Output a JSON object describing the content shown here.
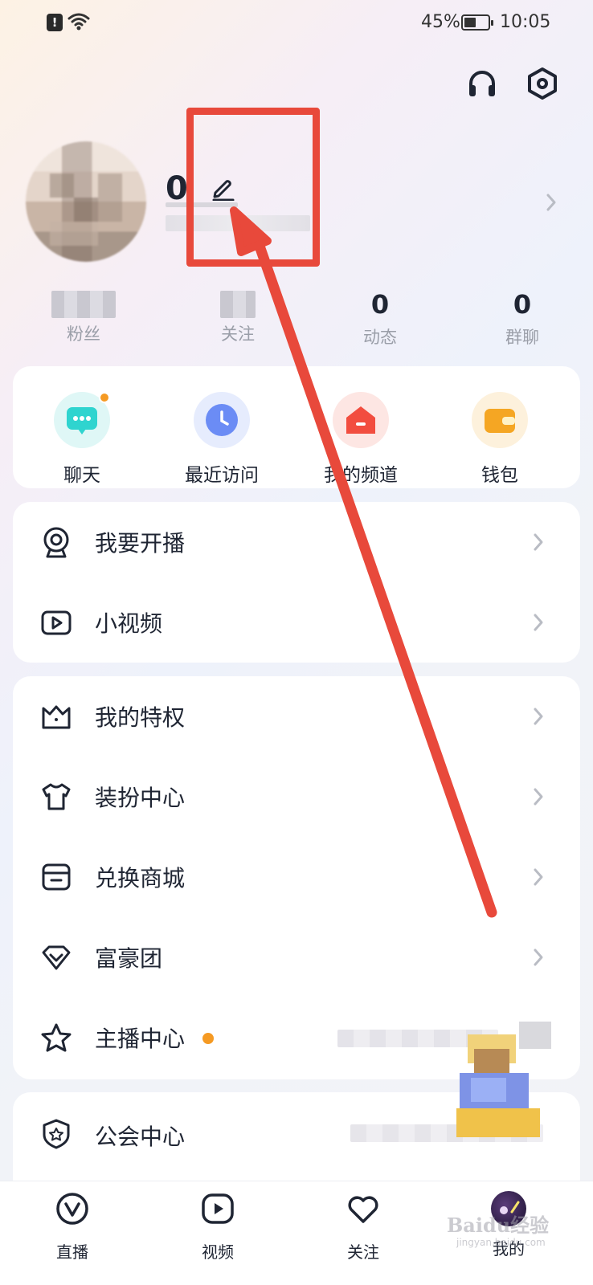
{
  "status_bar": {
    "battery_percent": "45%",
    "time": "10:05",
    "alert_glyph": "!"
  },
  "header": {
    "icons": [
      "headphones-icon",
      "settings-hexagon-icon"
    ]
  },
  "profile": {
    "name": "0"
  },
  "stats": [
    {
      "label": "粉丝",
      "value": ""
    },
    {
      "label": "关注",
      "value": ""
    },
    {
      "label": "动态",
      "value": "0"
    },
    {
      "label": "群聊",
      "value": "0"
    }
  ],
  "shortcuts": [
    {
      "label": "聊天",
      "icon": "chat-bubble-icon",
      "color": "#2fd4cf"
    },
    {
      "label": "最近访问",
      "icon": "clock-icon",
      "color": "#6b8cf5"
    },
    {
      "label": "我的频道",
      "icon": "house-icon",
      "color": "#f24d3f"
    },
    {
      "label": "钱包",
      "icon": "wallet-icon",
      "color": "#f5a623"
    }
  ],
  "menu_group_1": [
    {
      "label": "我要开播",
      "icon": "webcam-icon"
    },
    {
      "label": "小视频",
      "icon": "video-play-icon"
    }
  ],
  "menu_group_2": [
    {
      "label": "我的特权",
      "icon": "crown-icon"
    },
    {
      "label": "装扮中心",
      "icon": "tshirt-icon"
    },
    {
      "label": "兑换商城",
      "icon": "store-icon"
    },
    {
      "label": "富豪团",
      "icon": "diamond-icon"
    },
    {
      "label": "主播中心",
      "icon": "star-icon"
    }
  ],
  "menu_group_3": [
    {
      "label": "公会中心",
      "icon": "shield-star-icon"
    }
  ],
  "bottom_nav": [
    {
      "label": "直播",
      "icon": "live-icon"
    },
    {
      "label": "视频",
      "icon": "play-icon"
    },
    {
      "label": "关注",
      "icon": "heart-icon"
    },
    {
      "label": "我的",
      "icon": "avatar"
    }
  ],
  "watermark": {
    "text": "Baidu经验",
    "sub": "jingyan.baidu.com"
  },
  "colors": {
    "annotation_red": "#e8493b",
    "accent_orange": "#f59a23"
  }
}
